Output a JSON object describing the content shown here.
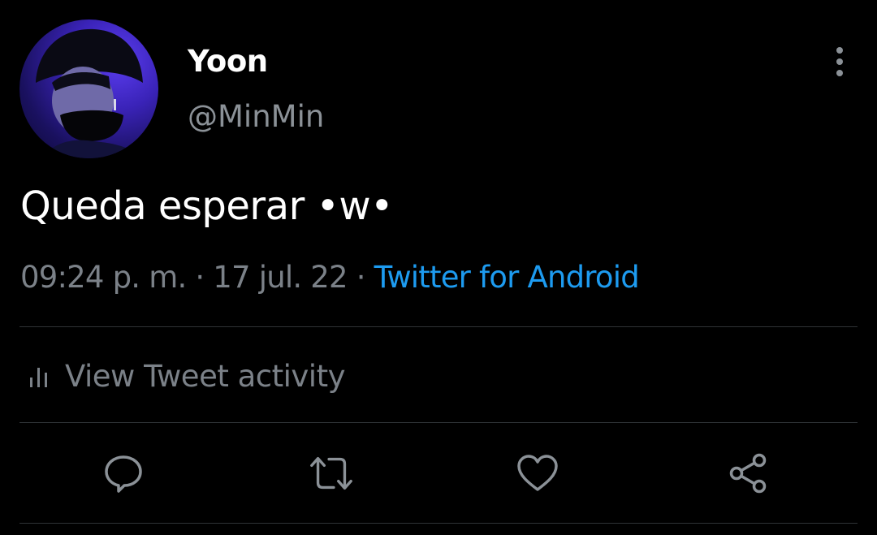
{
  "tweet": {
    "author": {
      "display_name": "Yoon",
      "handle": "@MinMin"
    },
    "text": "Queda esperar •w•",
    "time": "09:24 p. m.",
    "date": "17 jul. 22",
    "separator": " · ",
    "source": "Twitter for Android",
    "activity_label": "View Tweet activity"
  },
  "icons": {
    "more": "more-vertical-icon",
    "activity": "bar-chart-icon",
    "reply": "reply-icon",
    "retweet": "retweet-icon",
    "like": "heart-icon",
    "share": "share-icon"
  },
  "colors": {
    "background": "#000000",
    "text": "#ffffff",
    "muted": "#7b8188",
    "accent": "#1d9bf0",
    "divider": "#2f3336"
  }
}
